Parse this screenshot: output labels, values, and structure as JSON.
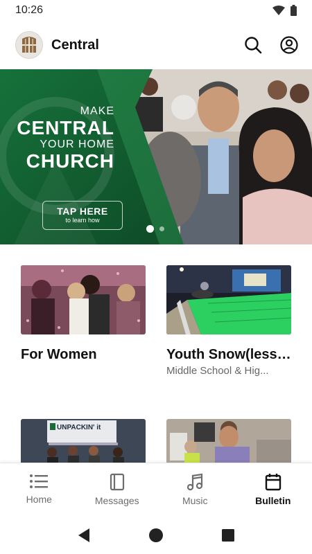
{
  "status": {
    "time": "10:26"
  },
  "app": {
    "title": "Central"
  },
  "hero": {
    "line1": "MAKE",
    "line2": "CENTRAL",
    "line3": "YOUR HOME",
    "line4": "CHURCH",
    "cta": "TAP HERE",
    "cta_sub": "to learn how",
    "slide_count": 2,
    "active_slide": 1
  },
  "cards": [
    {
      "title": "For Women",
      "subtitle": ""
    },
    {
      "title": "Youth Snow(less) Tu...",
      "subtitle": "Middle School & Hig..."
    },
    {
      "title": "",
      "subtitle": "",
      "image_text": "UNPACKIN' it"
    },
    {
      "title": "",
      "subtitle": ""
    }
  ],
  "nav": [
    {
      "label": "Home",
      "icon": "list-icon",
      "active": false
    },
    {
      "label": "Messages",
      "icon": "book-icon",
      "active": false
    },
    {
      "label": "Music",
      "icon": "music-note-icon",
      "active": false
    },
    {
      "label": "Bulletin",
      "icon": "calendar-icon",
      "active": true
    }
  ],
  "colors": {
    "brand_green": "#1f6b3a",
    "text": "#111111",
    "muted": "#6d6d6d"
  }
}
